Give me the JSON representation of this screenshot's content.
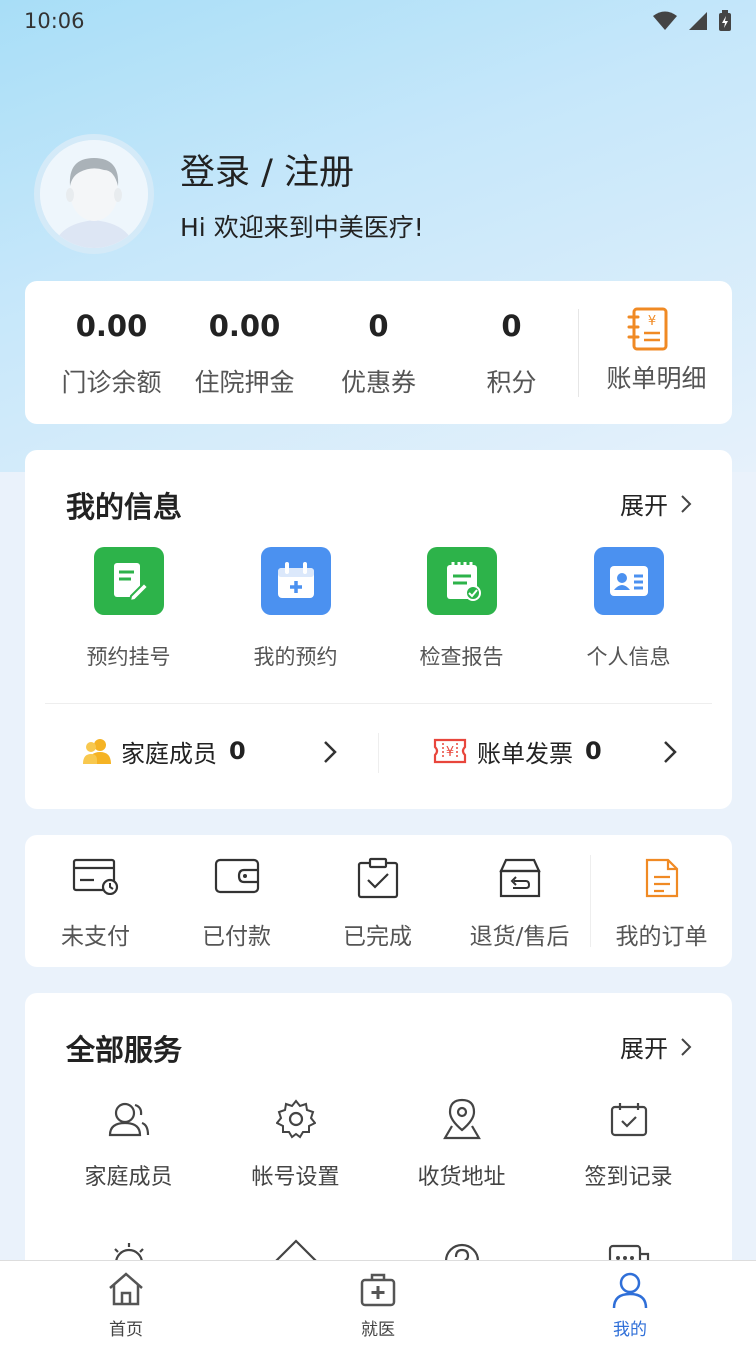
{
  "status_bar": {
    "time": "10:06"
  },
  "profile": {
    "login_label": "登录 / 注册",
    "welcome": "Hi 欢迎来到中美医疗!"
  },
  "stats": [
    {
      "value": "0.00",
      "label": "门诊余额"
    },
    {
      "value": "0.00",
      "label": "住院押金"
    },
    {
      "value": "0",
      "label": "优惠券"
    },
    {
      "value": "0",
      "label": "积分"
    }
  ],
  "bill_detail": {
    "label": "账单明细"
  },
  "my_info": {
    "title": "我的信息",
    "expand": "展开",
    "items": [
      {
        "label": "预约挂号",
        "icon": "register-doc-icon",
        "color": "#2db34a"
      },
      {
        "label": "我的预约",
        "icon": "calendar-plus-icon",
        "color": "#4b91f0"
      },
      {
        "label": "检查报告",
        "icon": "report-check-icon",
        "color": "#2db34a"
      },
      {
        "label": "个人信息",
        "icon": "id-card-icon",
        "color": "#4b91f0"
      }
    ],
    "family": {
      "label": "家庭成员",
      "count": "0"
    },
    "invoice": {
      "label": "账单发票",
      "count": "0"
    }
  },
  "orders": {
    "items": [
      {
        "label": "未支付",
        "icon": "unpaid-icon"
      },
      {
        "label": "已付款",
        "icon": "wallet-icon"
      },
      {
        "label": "已完成",
        "icon": "completed-icon"
      },
      {
        "label": "退货/售后",
        "icon": "return-icon"
      }
    ],
    "my_orders": "我的订单"
  },
  "services": {
    "title": "全部服务",
    "expand": "展开",
    "items": [
      {
        "label": "家庭成员",
        "icon": "family-icon"
      },
      {
        "label": "帐号设置",
        "icon": "gear-icon"
      },
      {
        "label": "收货地址",
        "icon": "location-icon"
      },
      {
        "label": "签到记录",
        "icon": "checkin-calendar-icon"
      }
    ]
  },
  "tabs": [
    {
      "label": "首页",
      "icon": "home-icon"
    },
    {
      "label": "就医",
      "icon": "medical-kit-icon"
    },
    {
      "label": "我的",
      "icon": "user-icon",
      "active": true
    }
  ],
  "colors": {
    "accent": "#2f6fd8",
    "green": "#2db34a",
    "blue": "#4b91f0",
    "orange": "#f08a24",
    "red": "#e8463c"
  }
}
